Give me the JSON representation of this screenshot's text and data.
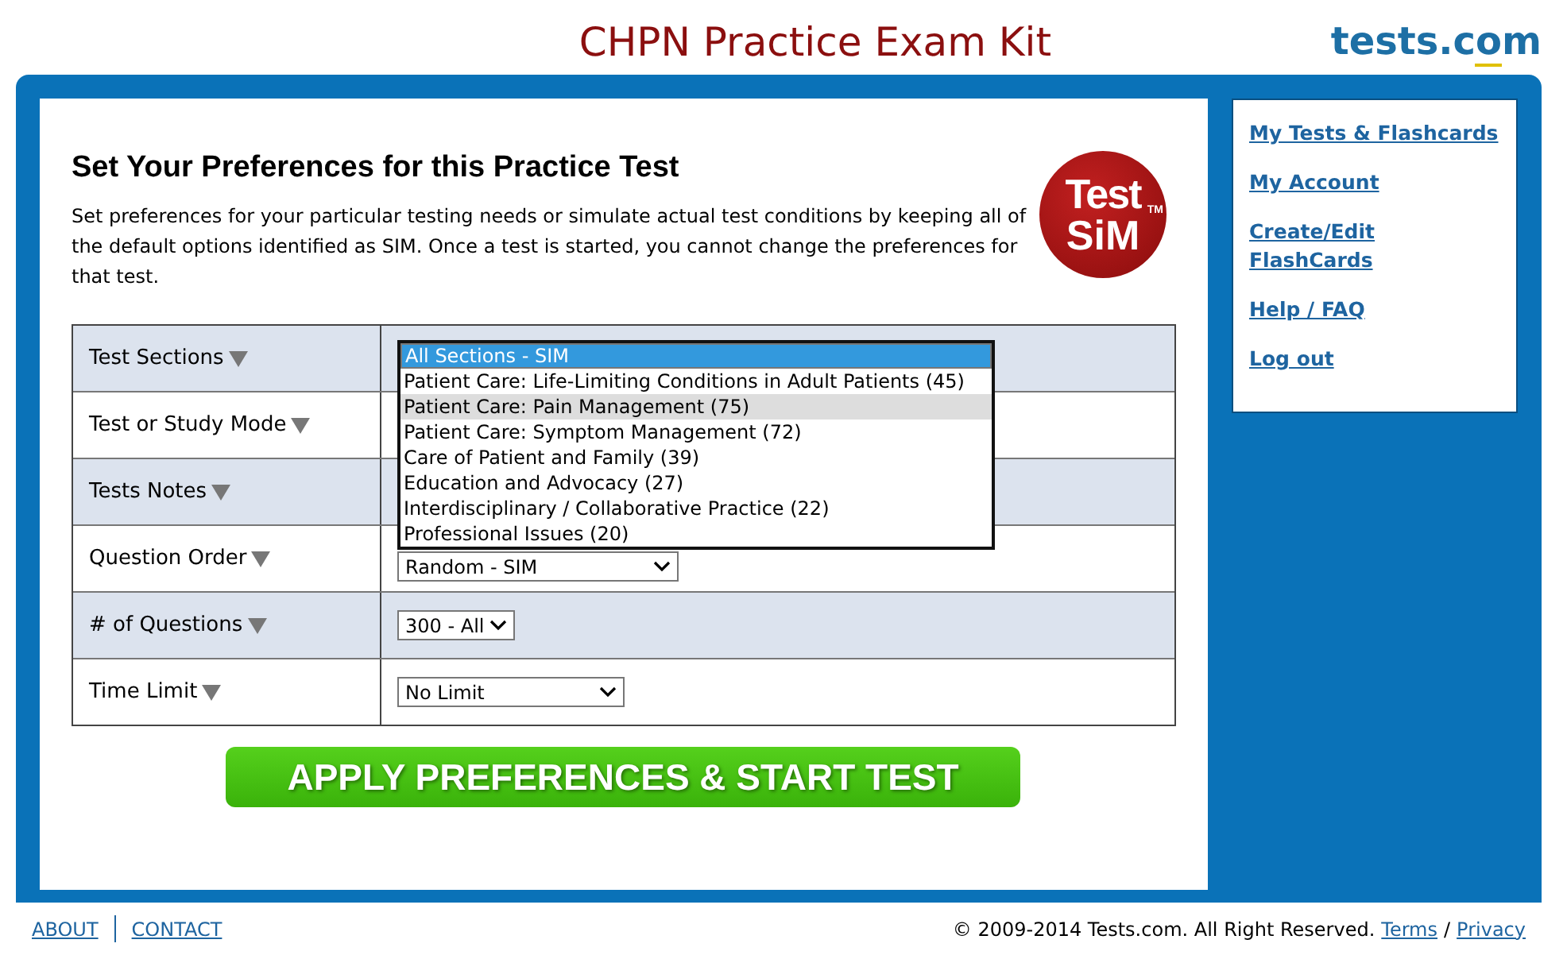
{
  "header": {
    "title": "CHPN Practice Exam Kit",
    "logo": {
      "text": "tests.c",
      "accent": "o",
      "end": "m"
    }
  },
  "main": {
    "heading": "Set Your Preferences for this Practice Test",
    "intro": "Set preferences for your particular testing needs or simulate actual test conditions by keeping all of the default options identified as SIM. Once a test is started, you cannot change the preferences for that test.",
    "badge": {
      "line1": "Test",
      "line2": "SiM",
      "mark": "TM"
    }
  },
  "preferences": [
    {
      "label": "Test Sections",
      "kind": "open"
    },
    {
      "label": "Test or Study Mode",
      "kind": "hidden"
    },
    {
      "label": "Tests Notes",
      "kind": "hidden"
    },
    {
      "label": "Question Order",
      "kind": "select",
      "value": "Random - SIM"
    },
    {
      "label": "# of Questions",
      "kind": "select",
      "value": "300 - All"
    },
    {
      "label": "Time Limit",
      "kind": "select",
      "value": "No Limit"
    }
  ],
  "dropdown_options": [
    {
      "label": "All Sections - SIM",
      "selected": true,
      "hovered": false
    },
    {
      "label": "Patient Care: Life-Limiting Conditions in Adult Patients (45)",
      "selected": false,
      "hovered": false
    },
    {
      "label": "Patient Care: Pain Management (75)",
      "selected": false,
      "hovered": true
    },
    {
      "label": "Patient Care: Symptom Management (72)",
      "selected": false,
      "hovered": false
    },
    {
      "label": "Care of Patient and Family (39)",
      "selected": false,
      "hovered": false
    },
    {
      "label": "Education and Advocacy (27)",
      "selected": false,
      "hovered": false
    },
    {
      "label": "Interdisciplinary / Collaborative Practice (22)",
      "selected": false,
      "hovered": false
    },
    {
      "label": "Professional Issues (20)",
      "selected": false,
      "hovered": false
    }
  ],
  "start_button": "APPLY PREFERENCES & START TEST",
  "sidebar": {
    "items": [
      "My Tests & Flashcards",
      "My Account",
      "Create/Edit FlashCards",
      "Help / FAQ",
      "Log out"
    ]
  },
  "footer": {
    "links": [
      "ABOUT",
      "CONTACT"
    ],
    "copyright": "© 2009-2014 Tests.com. All Right Reserved.",
    "legal_links": [
      "Terms",
      "Privacy"
    ],
    "separator": "/"
  }
}
